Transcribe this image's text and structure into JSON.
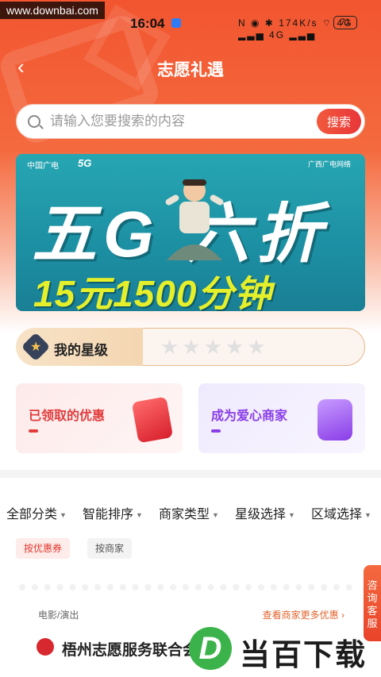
{
  "watermark_top": "www.downbai.com",
  "status_bar": {
    "time": "16:04",
    "icons": "N ◉ ✱ 174K/s ⌔ 4G ▂▃▅ 4G ▂▃▅",
    "battery": "71"
  },
  "nav": {
    "back_icon": "‹",
    "title": "志愿礼遇"
  },
  "search": {
    "placeholder": "请输入您要搜索的内容",
    "button_label": "搜索"
  },
  "banner": {
    "logo_left": "中国广电",
    "badge_5g": "5G",
    "logo_right": "广西广电网络",
    "headline": "五G 六折",
    "subline": "15元1500分钟"
  },
  "star_level": {
    "label": "我的星级",
    "stars": "★★★★★",
    "rating": 0,
    "max": 5
  },
  "cards": [
    {
      "title": "已领取的优惠"
    },
    {
      "title": "成为爱心商家"
    }
  ],
  "filters": [
    {
      "label": "全部分类"
    },
    {
      "label": "智能排序"
    },
    {
      "label": "商家类型"
    },
    {
      "label": "星级选择"
    },
    {
      "label": "区域选择"
    }
  ],
  "tags": [
    {
      "label": "按优惠券"
    },
    {
      "label": "按商家"
    }
  ],
  "merchant": {
    "category": "电影/演出",
    "more_link": "查看商家更多优惠 ›",
    "name": "梧州志愿服务联合会"
  },
  "consult_button": "咨询客服",
  "watermark_bottom": {
    "logo": "D",
    "text": "当百下载"
  },
  "colors": {
    "accent": "#f2552f",
    "search_button": "#e8363a",
    "banner_teal": "#1c8fa3",
    "tag_active": "#e2382f"
  }
}
